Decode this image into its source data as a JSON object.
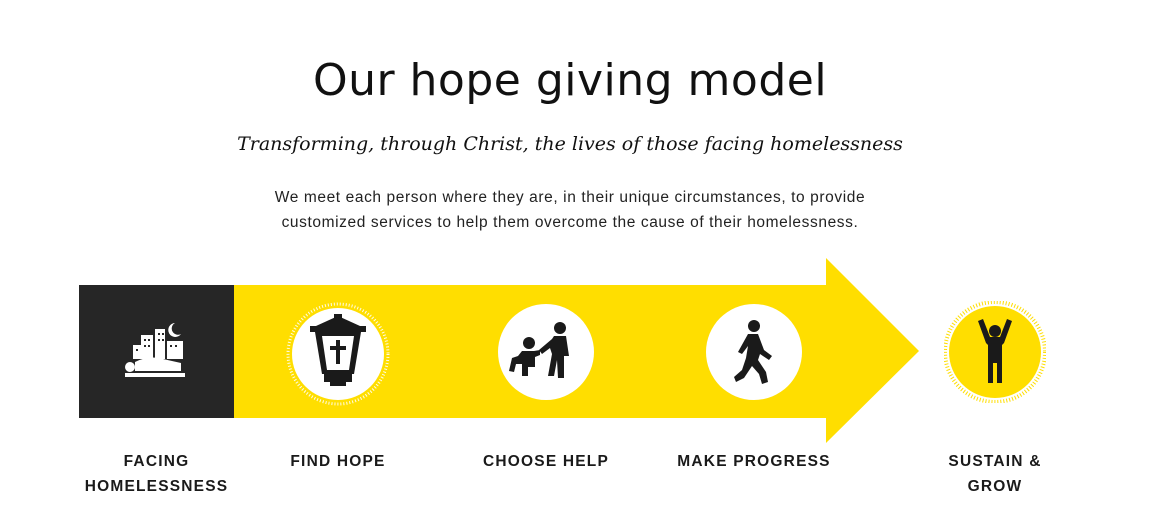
{
  "header": {
    "title": "Our hope giving model",
    "subtitle": "Transforming, through Christ, the lives of those facing homelessness",
    "intro": "We meet each person where they are, in their unique circumstances, to provide customized services to help them overcome the cause of their homelessness."
  },
  "colors": {
    "arrow_yellow": "#FFDE00",
    "dark_box": "#262626",
    "icon_circle": "#FFFFFF",
    "icon_glyph": "#1A1A1A"
  },
  "steps": [
    {
      "label": "FACING HOMELESSNESS",
      "icon": "sleeping-outdoors-icon"
    },
    {
      "label": "FIND HOPE",
      "icon": "lantern-cross-icon"
    },
    {
      "label": "CHOOSE HELP",
      "icon": "helping-hand-icon"
    },
    {
      "label": "MAKE PROGRESS",
      "icon": "walking-person-icon"
    },
    {
      "label": "SUSTAIN & GROW",
      "icon": "raised-arms-icon"
    }
  ]
}
